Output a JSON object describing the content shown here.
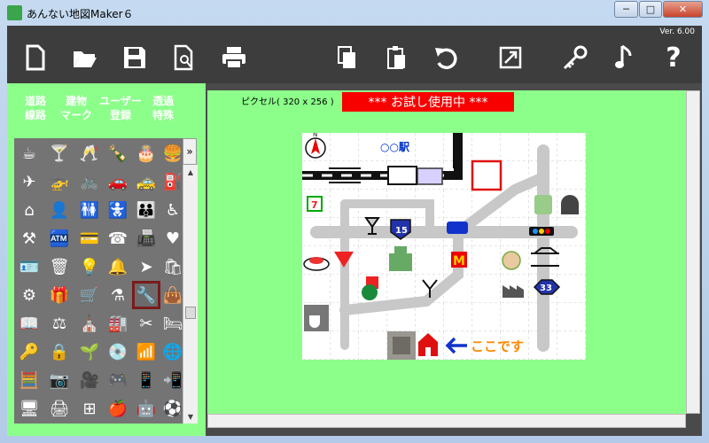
{
  "window": {
    "title": "あんない地図Maker６",
    "minimize": "─",
    "maximize": "□",
    "close": "✕"
  },
  "toolbar": {
    "version": "Ver. 6.00",
    "buttons": [
      "new-file-icon",
      "open-folder-icon",
      "save-disk-icon",
      "print-preview-icon",
      "printer-icon",
      "copy-icon",
      "paste-icon",
      "undo-icon",
      "resize-icon",
      "key-icon",
      "music-note-icon",
      "help-question-icon"
    ],
    "help_label": "?"
  },
  "categories": [
    {
      "line1": "道路",
      "line2": "線路"
    },
    {
      "line1": "建物",
      "line2": "マーク"
    },
    {
      "line1": "ユーザー",
      "line2": "登録"
    },
    {
      "line1": "透過",
      "line2": "特殊"
    }
  ],
  "palette": {
    "expand": "»",
    "scroll_up": "▲",
    "scroll_down": "▼"
  },
  "canvas": {
    "pixel_label": "ピクセル( 320 x 256 )",
    "trial_banner": "*** お試し使用中 ***",
    "station": "○○駅",
    "here": "ここです",
    "route15": "15",
    "route33": "33",
    "north": "N"
  },
  "colors": {
    "accent_green": "#8cff8a",
    "toolbar": "#3d3d3d",
    "trial_red": "#f80000",
    "station_blue": "#0033cc",
    "here_orange": "#ff8800"
  }
}
